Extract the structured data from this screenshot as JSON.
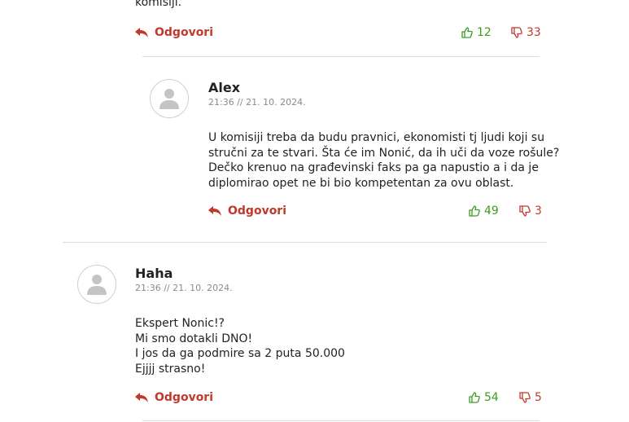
{
  "colors": {
    "accent": "#c0392b",
    "like": "#3d9b1f",
    "divider": "#dddddd"
  },
  "icons": {
    "reply": "reply-arrow-icon",
    "like": "thumbs-up-icon",
    "dislike": "thumbs-down-icon",
    "avatar": "user-silhouette-icon"
  },
  "top_comment": {
    "text_fragment": "komisiji.",
    "reply_label": "Odgovori",
    "likes": "12",
    "dislikes": "33"
  },
  "comments": [
    {
      "author": "Alex",
      "date": "21:36 // 21. 10. 2024.",
      "lines": [
        "U komisiji treba da budu pravnici, ekonomisti tj ljudi koji su",
        "stručni za te stvari. Šta će im Nonić, da ih uči da voze rošule?",
        "Dečko krenuo na građevinski faks pa ga napustio a i da je",
        "diplomirao opet ne bi bio kompetentan za ovu oblast."
      ],
      "reply_label": "Odgovori",
      "likes": "49",
      "dislikes": "3"
    },
    {
      "author": "Haha",
      "date": "21:36 // 21. 10. 2024.",
      "lines": [
        "Ekspert Nonic!?",
        "Mi smo dotakli DNO!",
        "I jos da ga podmire sa 2 puta 50.000",
        "Ejjjj strasno!"
      ],
      "reply_label": "Odgovori",
      "likes": "54",
      "dislikes": "5"
    }
  ]
}
